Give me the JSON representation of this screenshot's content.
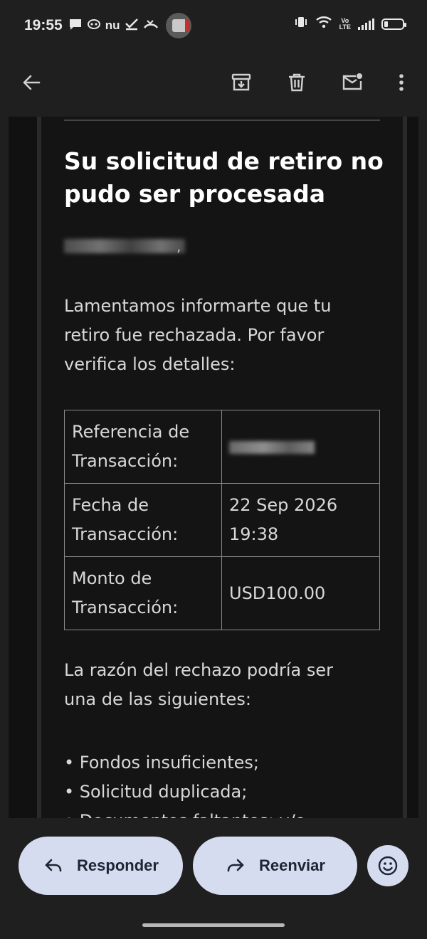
{
  "status_bar": {
    "time": "19:55",
    "notification_icons": [
      "chat-bubble-icon",
      "mask-icon",
      "nu-icon",
      "check-icon",
      "missed-call-icon"
    ],
    "nu_text": "nu",
    "volte_text": "Vo\nLTE",
    "system_icons": [
      "vibrate-icon",
      "wifi-icon",
      "signal-icon",
      "battery-icon"
    ]
  },
  "toolbar": {
    "icons": [
      "back-arrow-icon",
      "archive-icon",
      "delete-icon",
      "mark-unread-icon",
      "more-vert-icon"
    ]
  },
  "email": {
    "title": "Su solicitud de retiro no pudo ser procesada",
    "greeting_suffix": ",",
    "intro": "Lamentamos informarte que tu retiro fue rechazada. Por favor verifica los detalles:",
    "table": [
      {
        "label": "Referencia de Transacción:",
        "value": ""
      },
      {
        "label": "Fecha de Transacción:",
        "value": "22 Sep 2026 19:38"
      },
      {
        "label": "Monto de Transacción:",
        "value": "USD100.00"
      }
    ],
    "reason_intro": "La razón del rechazo podría ser una de las siguientes:",
    "reasons": [
      "• Fondos insuficientes;",
      "• Solicitud duplicada;",
      "• Documentos faltantes; y/o"
    ]
  },
  "actions": {
    "reply_label": "Responder",
    "forward_label": "Reenviar",
    "accent": "#d5dcef"
  }
}
